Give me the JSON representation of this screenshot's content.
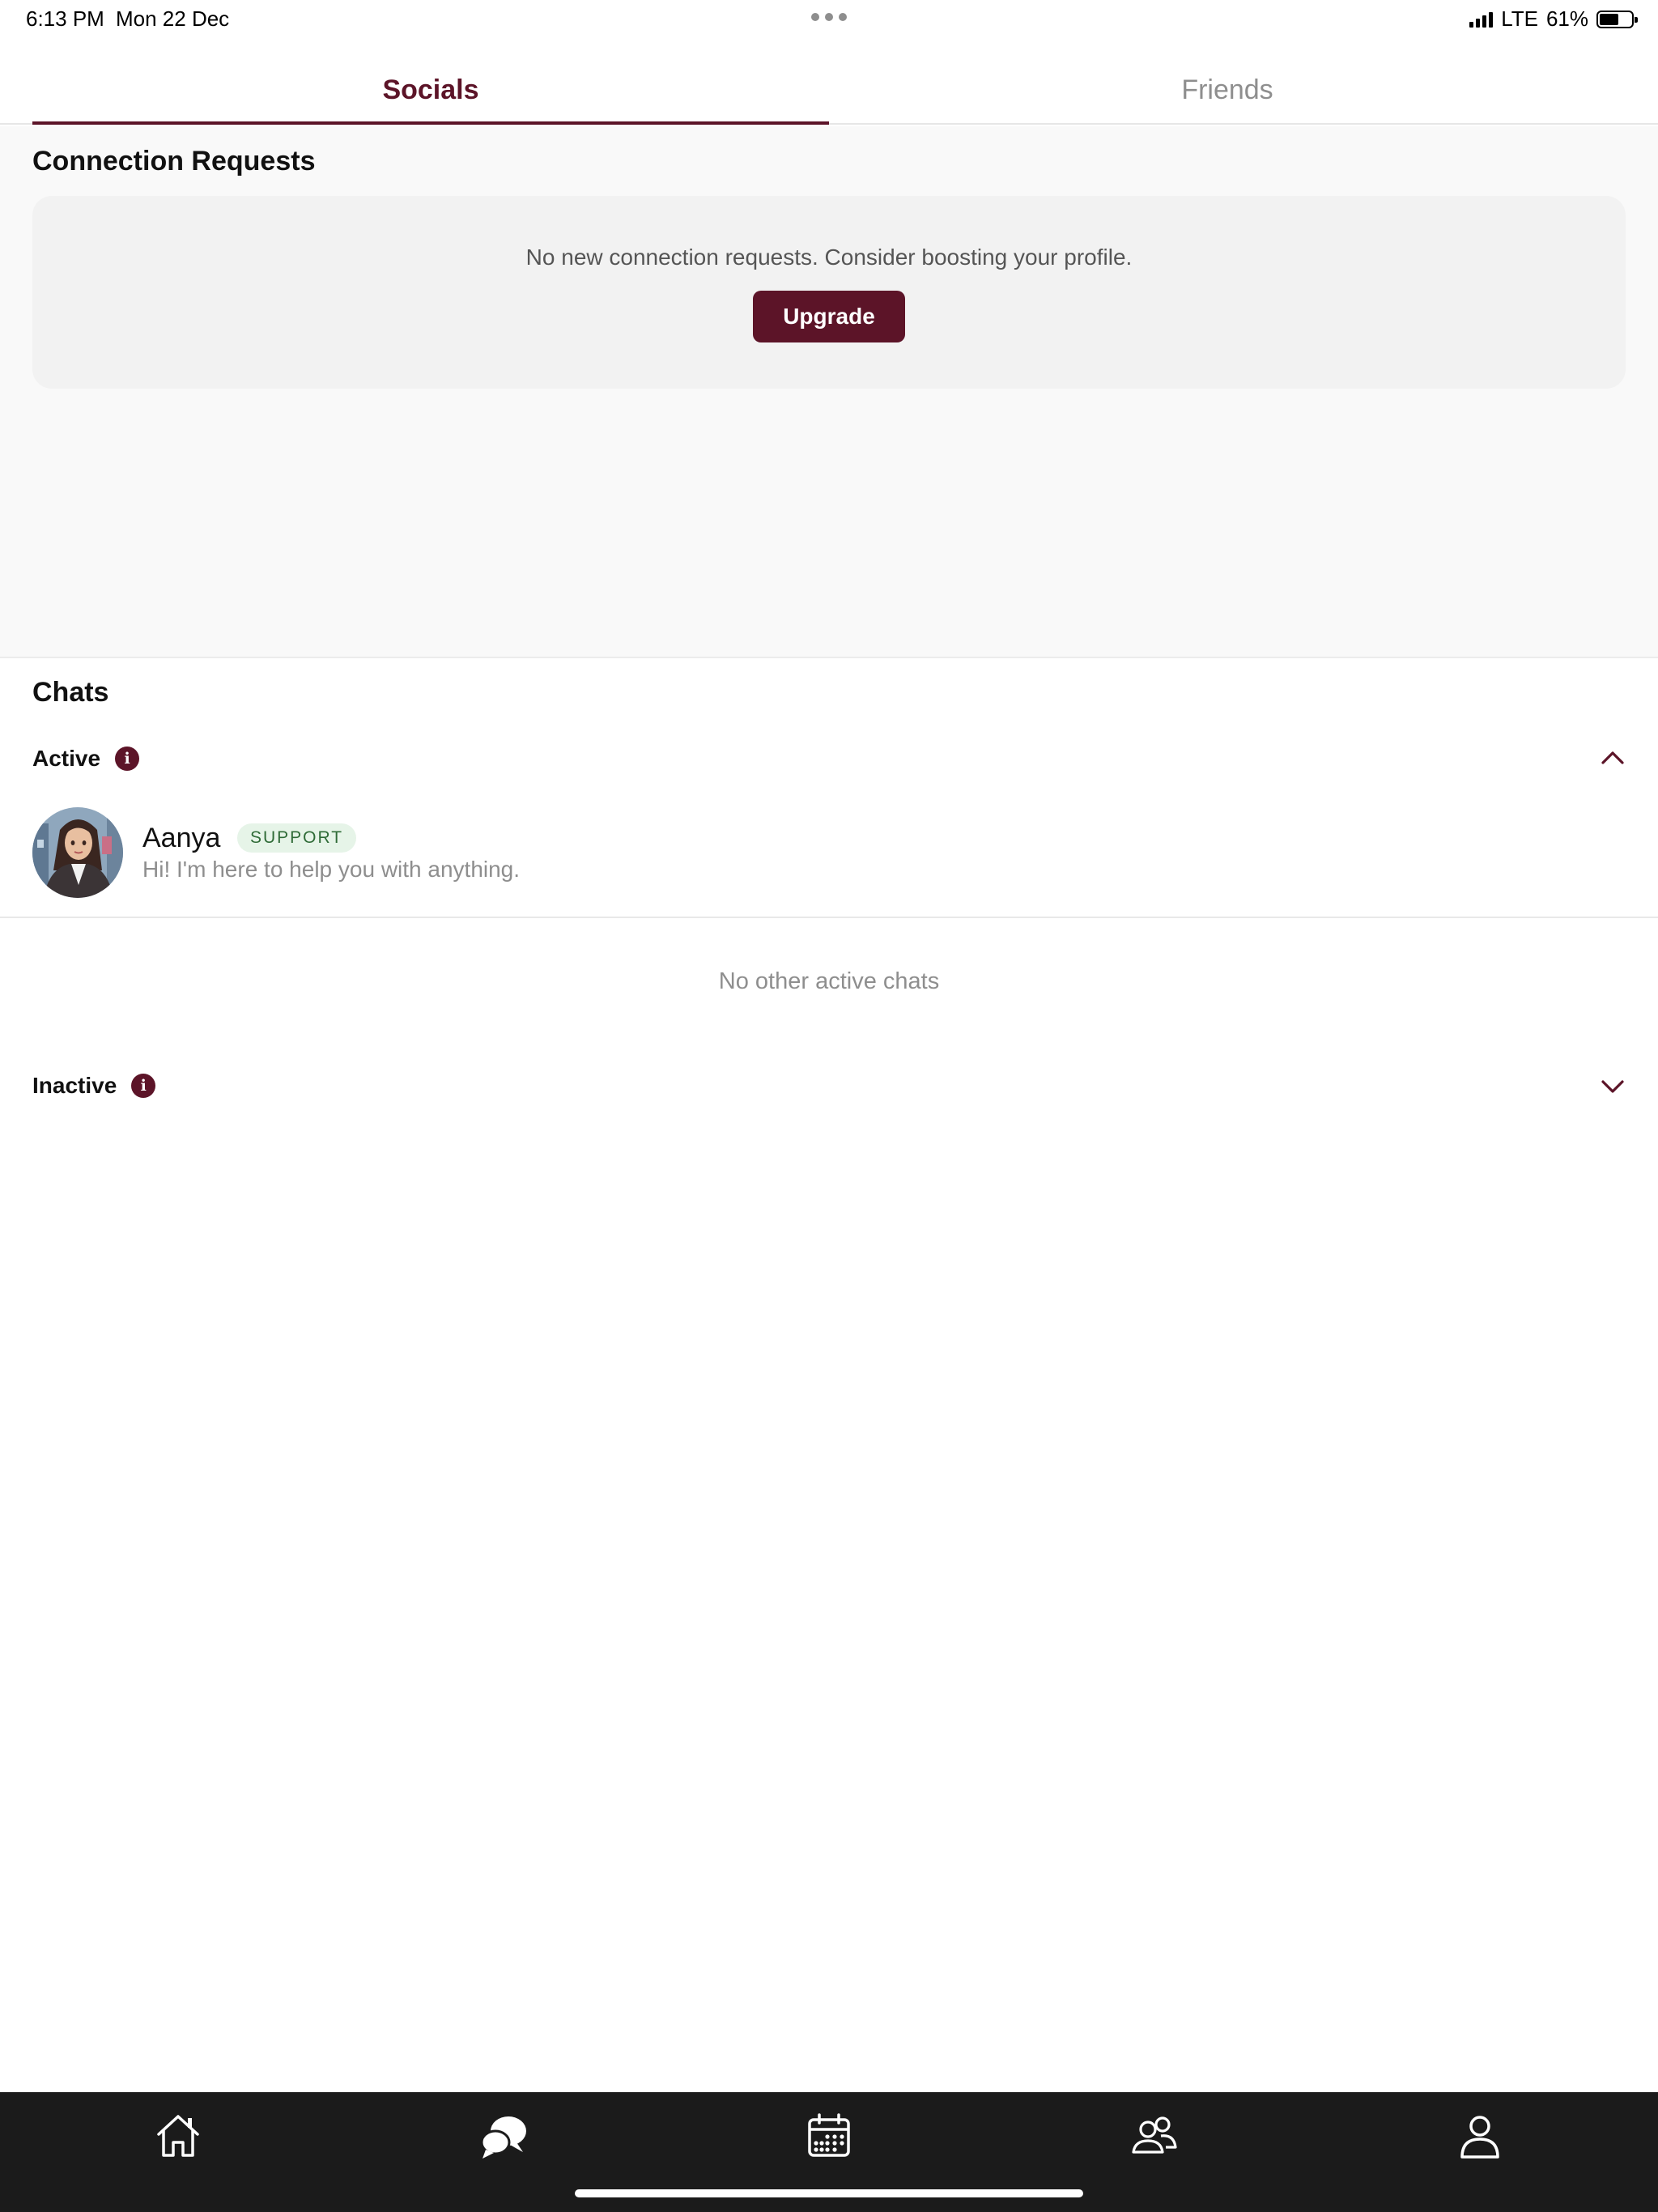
{
  "status_bar": {
    "time": "6:13 PM",
    "date": "Mon 22 Dec",
    "network": "LTE",
    "battery": "61%",
    "battery_level": 0.61
  },
  "tabs": [
    {
      "label": "Socials",
      "selected": true
    },
    {
      "label": "Friends",
      "selected": false
    }
  ],
  "connection_requests": {
    "title": "Connection Requests",
    "message": "No new connection requests. Consider boosting your profile.",
    "upgrade_label": "Upgrade"
  },
  "chats": {
    "title": "Chats",
    "active": {
      "label": "Active",
      "expanded": true,
      "items": [
        {
          "name": "Aanya",
          "badge": "SUPPORT",
          "preview": "Hi! I'm here to help you with anything."
        }
      ],
      "empty_message": "No other active chats"
    },
    "inactive": {
      "label": "Inactive",
      "expanded": false
    }
  },
  "bottom_nav": [
    {
      "icon": "home-icon"
    },
    {
      "icon": "chat-bubbles-icon"
    },
    {
      "icon": "calendar-icon"
    },
    {
      "icon": "friends-icon"
    },
    {
      "icon": "profile-icon"
    }
  ],
  "colors": {
    "accent": "#5c1428",
    "badge_bg": "#e6f4e8",
    "badge_text": "#2f6b37",
    "nav_bg": "#1b1b1b"
  }
}
